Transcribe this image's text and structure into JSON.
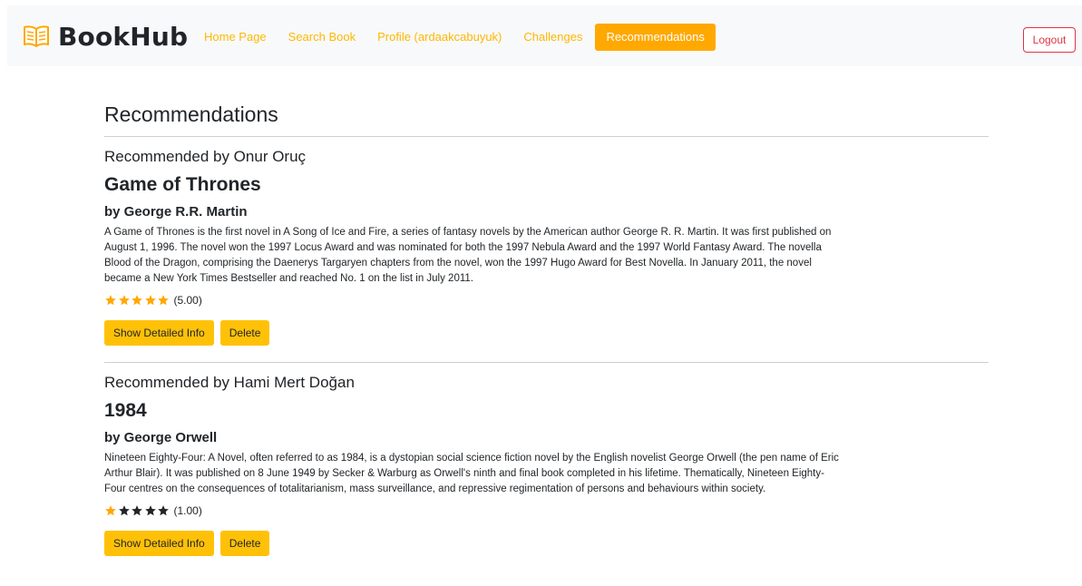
{
  "nav": {
    "brand": "BookHub",
    "links": [
      "Home Page",
      "Search Book",
      "Profile (ardaakcabuyuk)",
      "Challenges"
    ],
    "active": "Recommendations",
    "logout": "Logout",
    "brand_color": "#ffa800"
  },
  "page": {
    "title": "Recommendations"
  },
  "recommendations": [
    {
      "recommender": "Recommended by Onur Oruç",
      "title": "Game of Thrones",
      "author": "by George R.R. Martin",
      "description": "A Game of Thrones is the first novel in A Song of Ice and Fire, a series of fantasy novels by the American author George R. R. Martin. It was first published on August 1, 1996. The novel won the 1997 Locus Award and was nominated for both the 1997 Nebula Award and the 1997 World Fantasy Award. The novella Blood of the Dragon, comprising the Daenerys Targaryen chapters from the novel, won the 1997 Hugo Award for Best Novella. In January 2011, the novel became a New York Times Bestseller and reached No. 1 on the list in July 2011.",
      "rating": 5,
      "rating_text": "(5.00)",
      "detail_label": "Show Detailed Info",
      "delete_label": "Delete"
    },
    {
      "recommender": "Recommended by Hami Mert Doğan",
      "title": "1984",
      "author": "by George Orwell",
      "description": "Nineteen Eighty-Four: A Novel, often referred to as 1984, is a dystopian social science fiction novel by the English novelist George Orwell (the pen name of Eric Arthur Blair). It was published on 8 June 1949 by Secker & Warburg as Orwell's ninth and final book completed in his lifetime. Thematically, Nineteen Eighty-Four centres on the consequences of totalitarianism, mass surveillance, and repressive regimentation of persons and behaviours within society.",
      "rating": 1,
      "rating_text": "(1.00)",
      "detail_label": "Show Detailed Info",
      "delete_label": "Delete"
    }
  ],
  "colors": {
    "star_filled": "#ffa800",
    "star_empty": "#212529",
    "button": "#ffc107",
    "danger": "#dc3545"
  },
  "icons": {
    "brand": "open-book-icon",
    "rating": "star-icon"
  }
}
